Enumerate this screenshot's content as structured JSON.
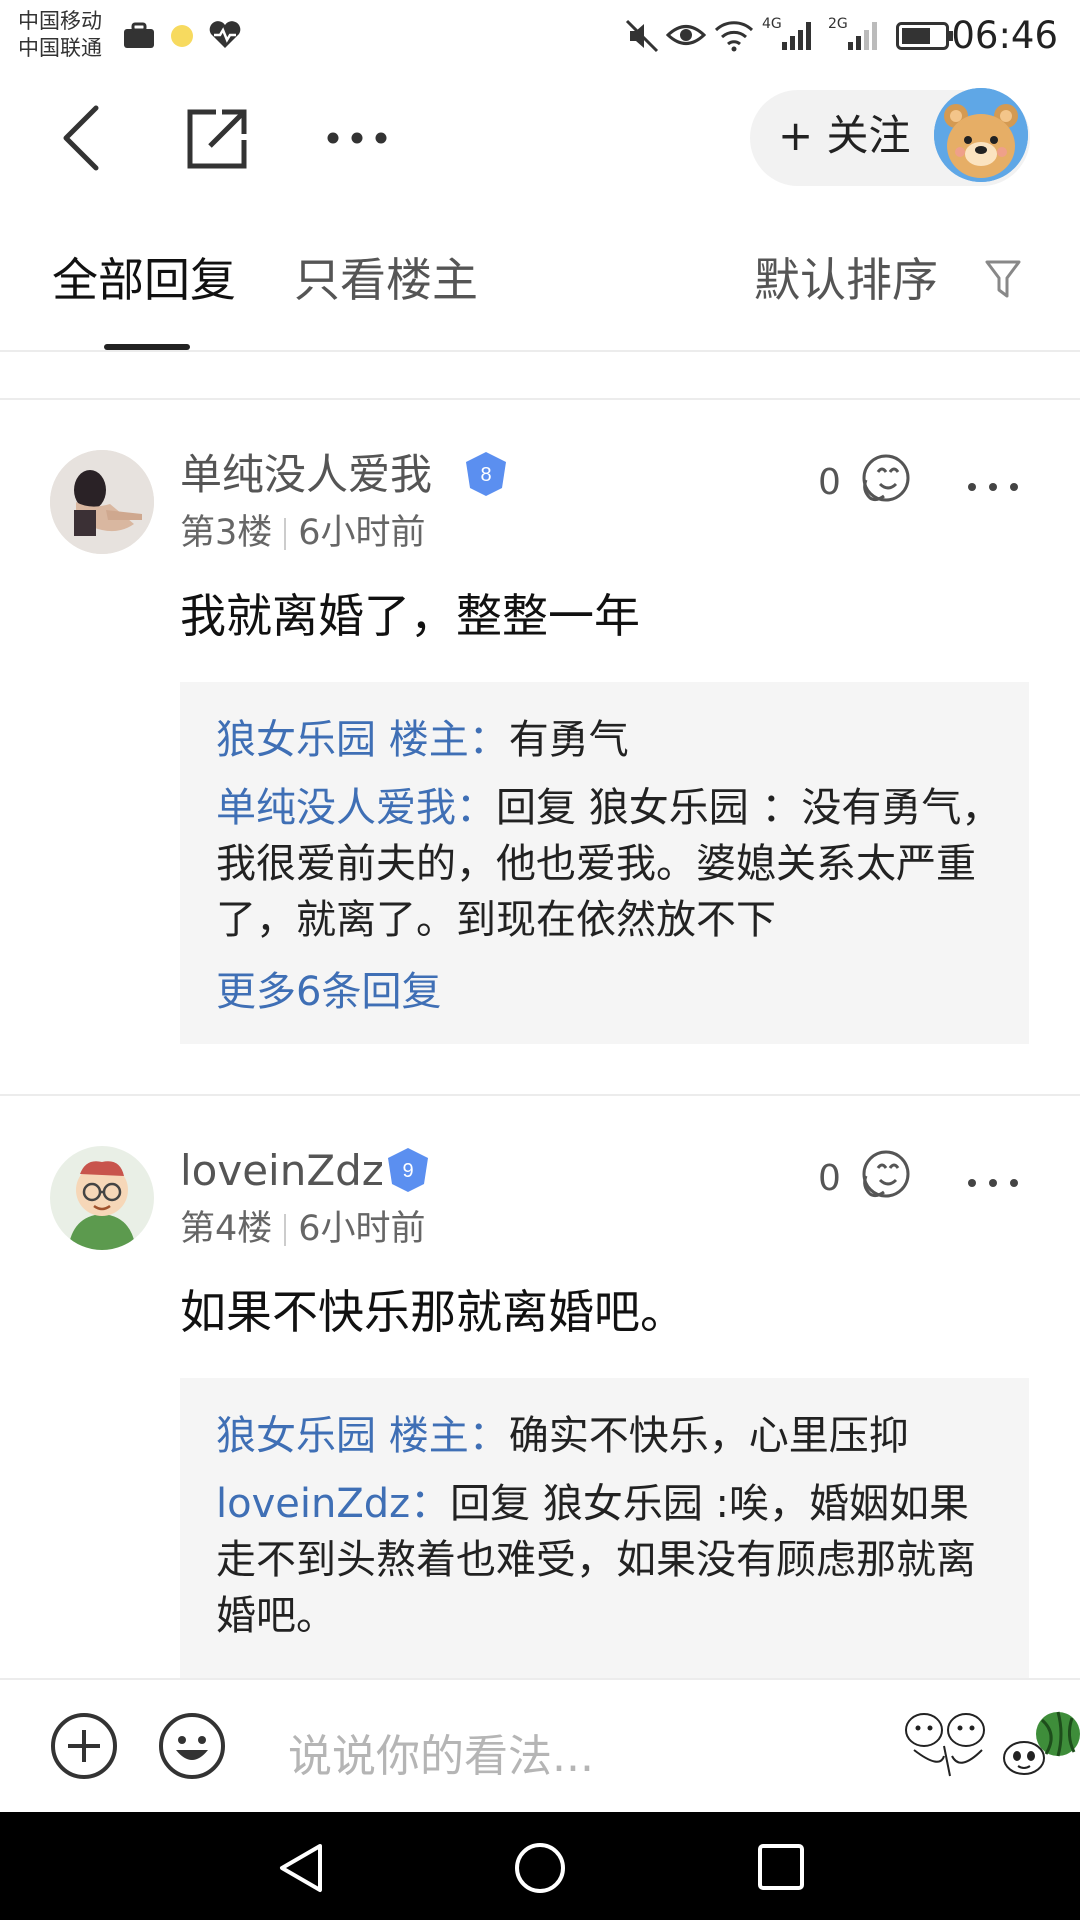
{
  "status_bar": {
    "carrier_1": "中国移动",
    "carrier_2": "中国联通",
    "net_1": "4G",
    "net_2": "2G",
    "time": "06:46"
  },
  "header": {
    "follow_label": "+ 关注"
  },
  "tabs": {
    "all_replies": "全部回复",
    "only_op": "只看楼主",
    "sort_label": "默认排序"
  },
  "posts": [
    {
      "username": "单纯没人爱我",
      "level": "8",
      "floor": "第3楼",
      "time": "6小时前",
      "likes": "0",
      "content": "我就离婚了，整整一年",
      "replies": [
        {
          "name": "狼女乐园 楼主：",
          "text": "有勇气"
        },
        {
          "name": "单纯没人爱我：",
          "text": "回复 狼女乐园 ：没有勇气，我很爱前夫的，他也爱我。婆媳关系太严重了，就离了。到现在依然放不下"
        }
      ],
      "more_replies": "更多6条回复"
    },
    {
      "username": "loveinZdz",
      "level": "9",
      "floor": "第4楼",
      "time": "6小时前",
      "likes": "0",
      "content": "如果不快乐那就离婚吧。",
      "replies": [
        {
          "name": "狼女乐园 楼主：",
          "text": "确实不快乐，心里压抑"
        },
        {
          "name": "loveinZdz：",
          "text": "回复 狼女乐园 :唉，婚姻如果走不到头熬着也难受，如果没有顾虑那就离婚吧。"
        }
      ]
    }
  ],
  "input_bar": {
    "placeholder": "说说你的看法..."
  },
  "colors": {
    "link_blue": "#3f6fb5",
    "badge_blue": "#5b8ff0",
    "reply_bg": "#f5f5f5"
  }
}
